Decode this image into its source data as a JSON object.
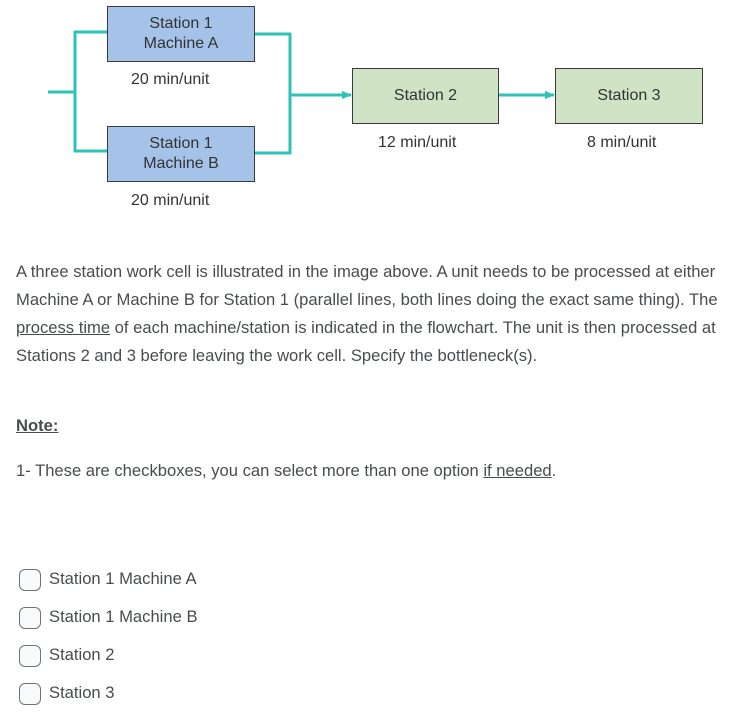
{
  "diagram": {
    "colors": {
      "connector": "#2ec2b8",
      "station1_fill": "#a5c3e9",
      "downstream_fill": "#d0e4c5",
      "box_border": "#3a3a3a"
    },
    "machine_a": {
      "line1": "Station 1",
      "line2": "Machine A",
      "rate": "20 min/unit"
    },
    "machine_b": {
      "line1": "Station 1",
      "line2": "Machine B",
      "rate": "20 min/unit"
    },
    "station_2": {
      "label": "Station 2",
      "rate": "12 min/unit"
    },
    "station_3": {
      "label": "Station 3",
      "rate": "8 min/unit"
    }
  },
  "question": {
    "part1": "A three station work cell is illustrated in the image above. A unit needs to be processed at either Machine A or Machine B for Station 1 (parallel lines, both lines doing the exact same thing). The ",
    "underlined_term": "process time",
    "part2": " of each machine/station is indicated in the flowchart. The unit is then processed at Stations 2 and 3 before leaving the work cell. Specify the bottleneck(s)."
  },
  "note": {
    "heading": "Note:",
    "text_before": "1- These are checkboxes, you can select more than one option ",
    "underlined": "if needed",
    "text_after": "."
  },
  "options": [
    {
      "label": "Station 1 Machine A",
      "checked": false
    },
    {
      "label": "Station 1 Machine B",
      "checked": false
    },
    {
      "label": "Station 2",
      "checked": false
    },
    {
      "label": "Station 3",
      "checked": false
    }
  ]
}
